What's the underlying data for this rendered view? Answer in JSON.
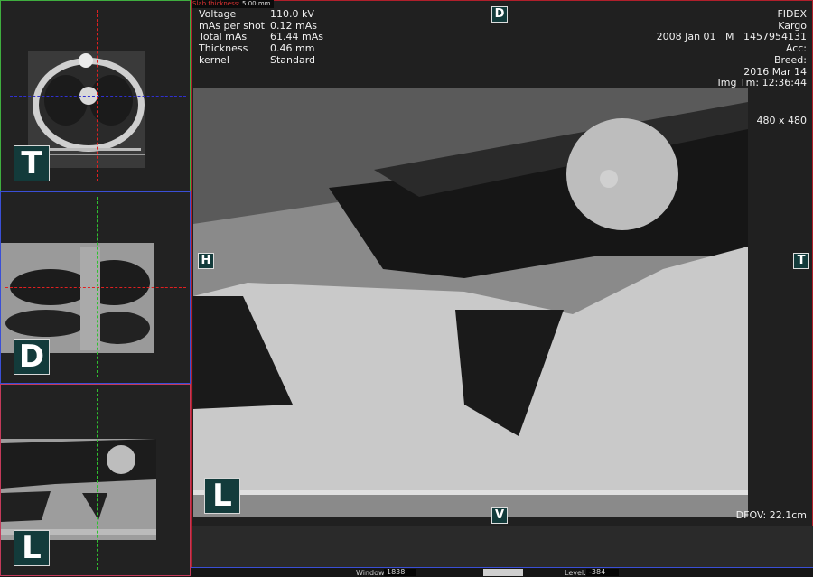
{
  "slab": {
    "label": "Slab thickness:",
    "value": "5.00 mm"
  },
  "acquisition": [
    {
      "key": "Voltage",
      "value": "110.0 kV"
    },
    {
      "key": "mAs per shot",
      "value": "0.12 mAs"
    },
    {
      "key": "Total mAs",
      "value": "61.44 mAs"
    },
    {
      "key": "Thickness",
      "value": "0.46 mm"
    },
    {
      "key": "kernel",
      "value": "Standard"
    }
  ],
  "patient": {
    "institution": "FIDEX",
    "name": "Kargo",
    "study_line": "2008 Jan 01   M   1457954131",
    "acc": "Acc:",
    "breed": "Breed:",
    "date": "2016 Mar 14",
    "img_time": "Img Tm: 12:36:44"
  },
  "matrix": "480 x 480",
  "dfov": "DFOV: 22.1cm",
  "orientation": {
    "top": "D",
    "bottom": "V",
    "left": "H",
    "right": "T"
  },
  "thumbnails": [
    {
      "id": "transverse",
      "badge": "T",
      "color": "#3fae3f"
    },
    {
      "id": "dorsal",
      "badge": "D",
      "color": "#3a4fd6"
    },
    {
      "id": "lateral",
      "badge": "L",
      "color": "#c33a5a"
    }
  ],
  "main_badge": "L",
  "window_level": {
    "window_label": "Window:",
    "window": "1838",
    "level_label": "Level:",
    "level": "-384"
  }
}
